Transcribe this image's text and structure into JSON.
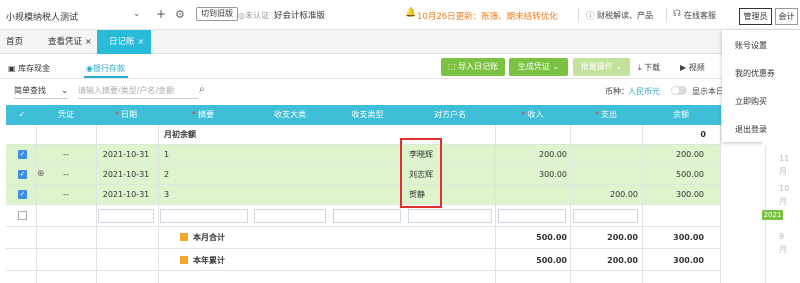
{
  "header": {
    "company": "小规模纳税人测试",
    "old_version": "切到旧版",
    "unauth": "未认证",
    "edition": "好会计标准版",
    "notice": "10月26日更新：账簿、期末结转优化",
    "news": "财税解读、产品",
    "support": "在线客服",
    "admin": "管理员",
    "account": "会计"
  },
  "tabs": [
    {
      "label": "首页"
    },
    {
      "label": "查看凭证"
    },
    {
      "label": "日记账",
      "active": true
    }
  ],
  "subtabs": {
    "cash": "库存现金",
    "bank": "银行存款"
  },
  "toolbar": {
    "import": "导入日记账",
    "gen_voucher": "生成凭证",
    "batch": "批量操作",
    "download": "下载",
    "video": "视频"
  },
  "filter": {
    "mode": "简单查找",
    "placeholder": "请输入摘要/类型/户名/金额",
    "currency_label": "币种：",
    "currency_value": "人民币元",
    "show_label": "显示本日"
  },
  "table": {
    "headers": [
      "凭证",
      "日期",
      "摘要",
      "收支大类",
      "收支类型",
      "对方户名",
      "收入",
      "支出",
      "余额"
    ],
    "opening_label": "月初余额",
    "opening_balance": "0",
    "rows": [
      {
        "voucher": "--",
        "date": "2021-10-31",
        "summary": "1",
        "party": "李晓辉",
        "income": "200.00",
        "expense": "",
        "balance": "200.00"
      },
      {
        "voucher": "--",
        "date": "2021-10-31",
        "summary": "2",
        "party": "刘志辉",
        "income": "300.00",
        "expense": "",
        "balance": "500.00"
      },
      {
        "voucher": "--",
        "date": "2021-10-31",
        "summary": "3",
        "party": "贺静",
        "income": "",
        "expense": "200.00",
        "balance": "300.00"
      }
    ],
    "month_total": {
      "label": "本月合计",
      "income": "500.00",
      "expense": "200.00",
      "balance": "300.00"
    },
    "year_total": {
      "label": "本年累计",
      "income": "500.00",
      "expense": "200.00",
      "balance": "300.00"
    }
  },
  "menu": [
    "账号设置",
    "我的优惠券",
    "立即购买",
    "退出登录"
  ],
  "calendar": {
    "n11": "11",
    "m11": "月",
    "n10": "10",
    "m10": "月",
    "badge": "2021",
    "n9": "9",
    "m9": "月"
  },
  "colors": {
    "accent": "#29bbd9",
    "green": "#7bc142",
    "row": "#def4cc",
    "notice": "#f07d1a"
  }
}
